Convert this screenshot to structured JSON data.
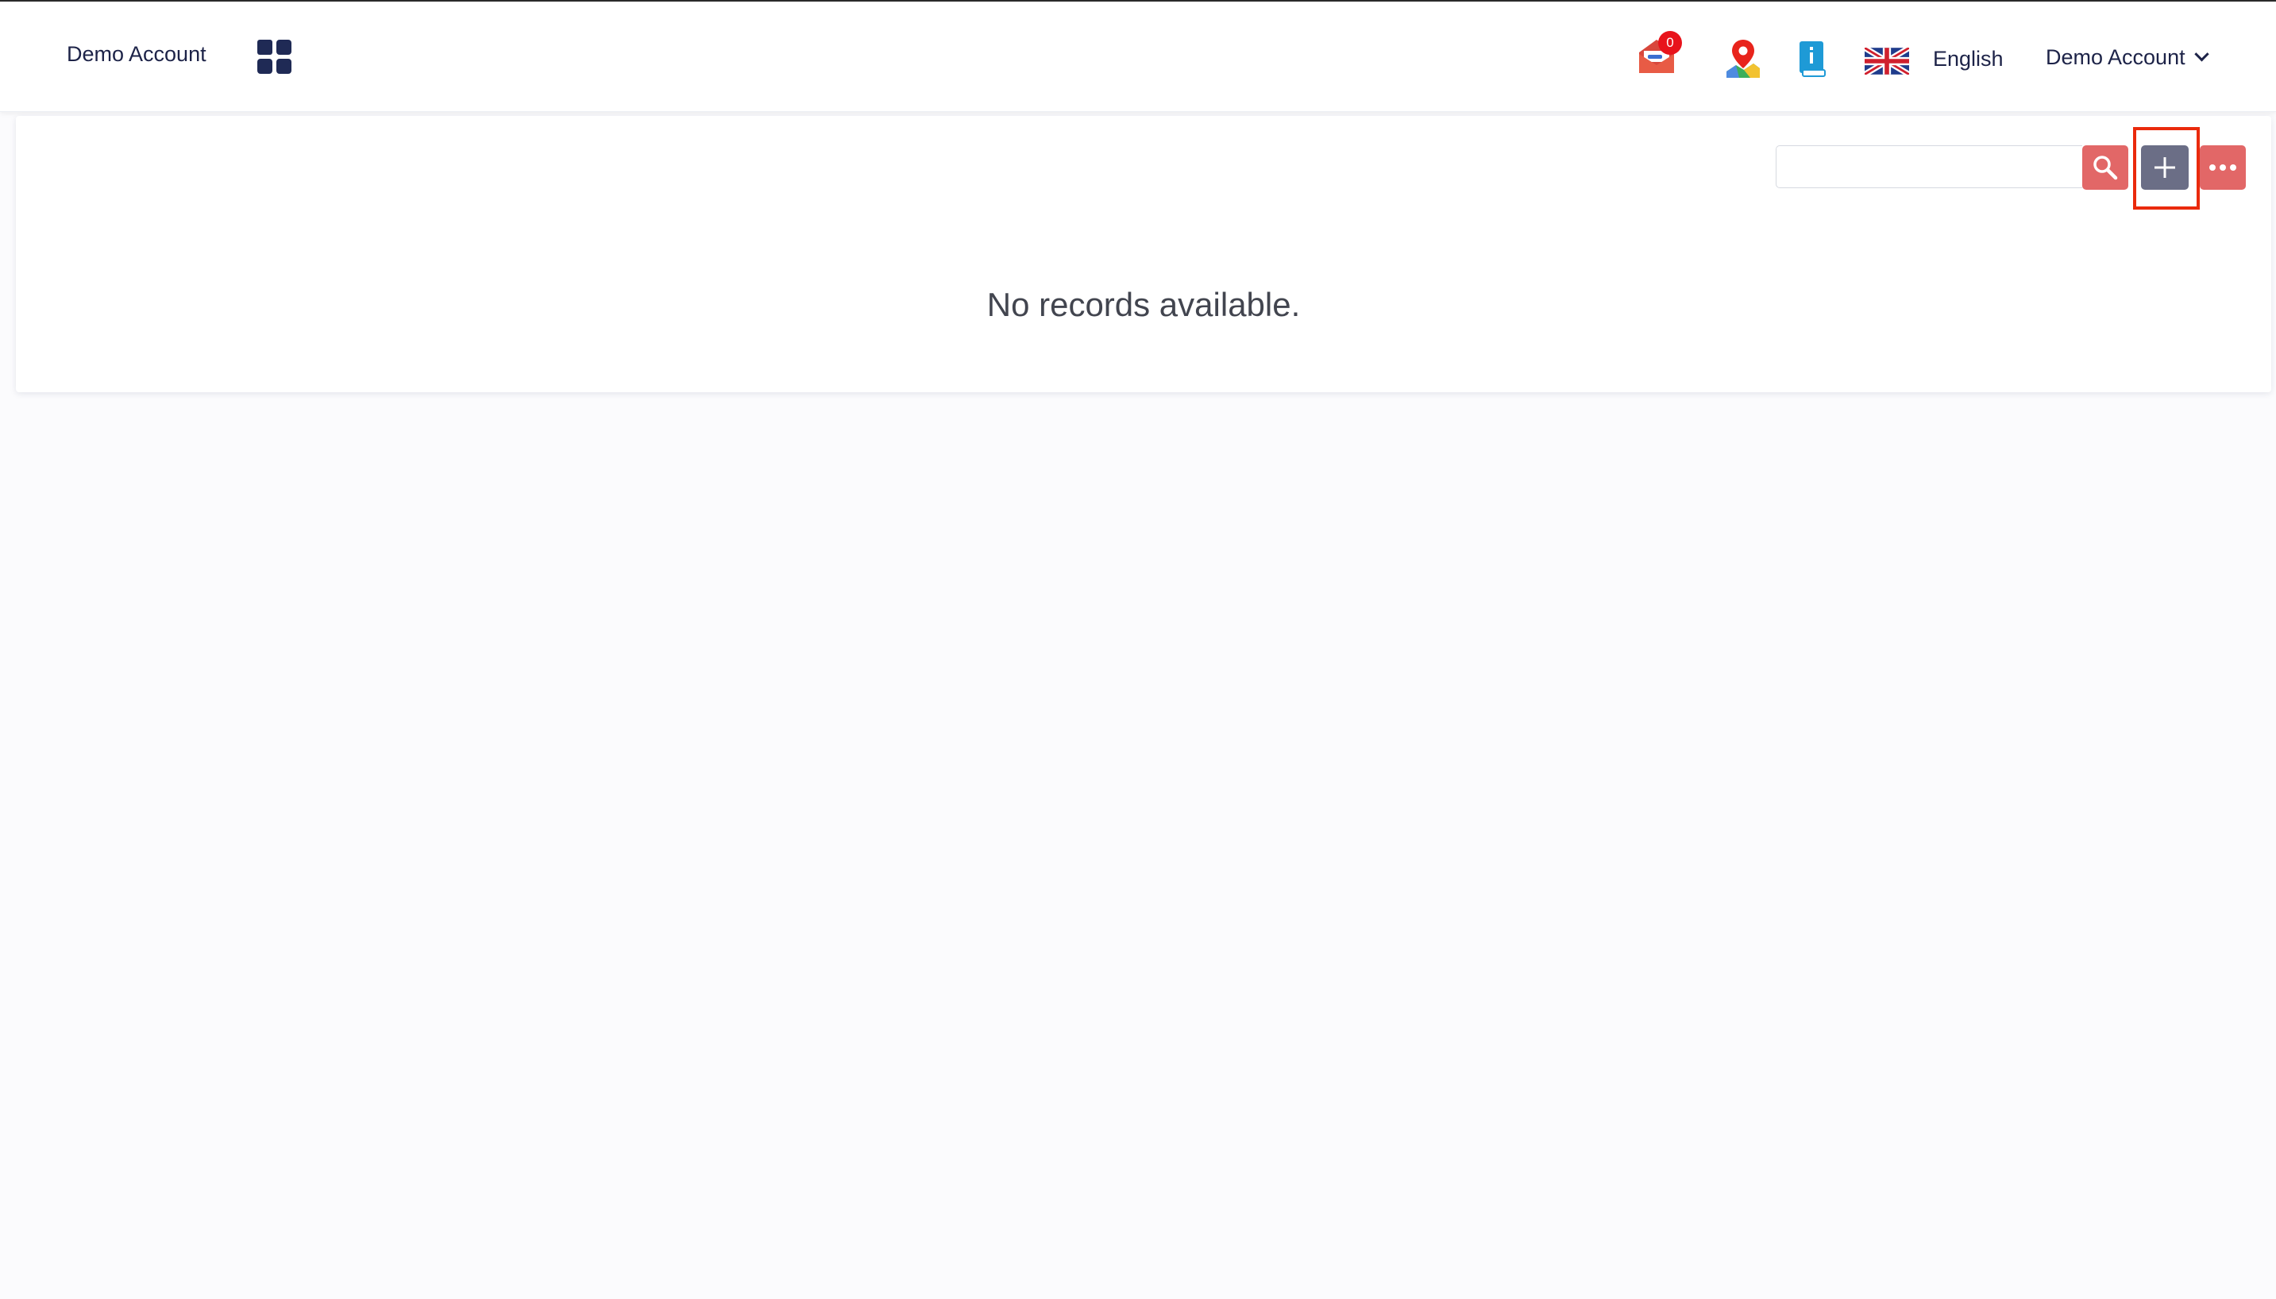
{
  "header": {
    "brand": "Demo Account",
    "apps_icon": "apps-grid-icon",
    "notifications": {
      "icon": "mail-icon",
      "count": "0",
      "badge_color": "#e8131b"
    },
    "map_icon": "map-pin-icon",
    "help_icon": "info-book-icon",
    "language": {
      "flag": "uk-flag-icon",
      "label": "English"
    },
    "user_menu": {
      "label": "Demo Account",
      "icon": "chevron-down-icon"
    }
  },
  "toolbar": {
    "search": {
      "value": "",
      "placeholder": ""
    },
    "search_icon": "search-icon",
    "add_icon": "plus-icon",
    "more_icon": "more-dots-icon",
    "colors": {
      "search": "#e26767",
      "add": "#6b6e86",
      "more": "#e26767",
      "highlight": "#ea2a0c"
    }
  },
  "content": {
    "empty_message": "No records available."
  }
}
